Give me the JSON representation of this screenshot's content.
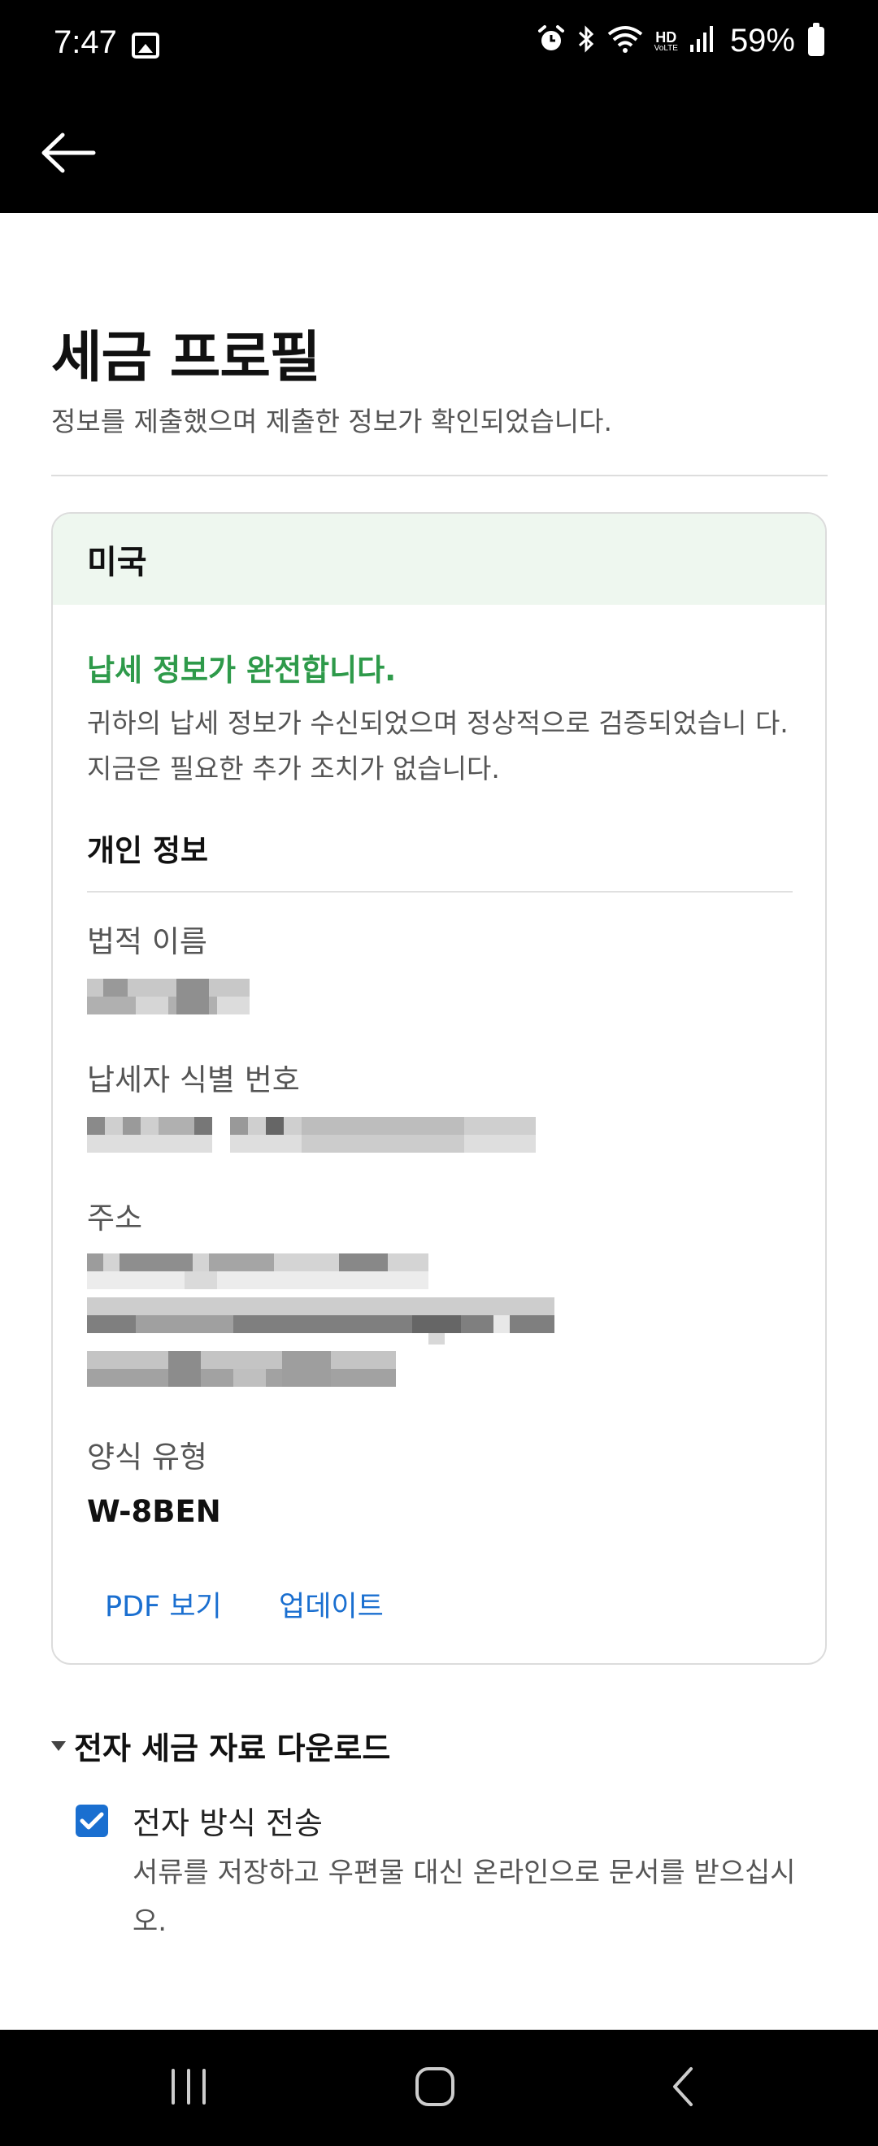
{
  "status_bar": {
    "time": "7:47",
    "battery": "59%",
    "icons": [
      "image-icon",
      "alarm-icon",
      "bluetooth-icon",
      "wifi-icon",
      "hd-voice-icon",
      "signal-icon",
      "battery-icon"
    ],
    "hd_top": "HD",
    "hd_bottom": "VoLTE"
  },
  "app_bar": {
    "back_icon": "arrow-left-icon"
  },
  "page": {
    "title": "세금 프로필",
    "subtitle": "정보를 제출했으며 제출한 정보가 확인되었습니다."
  },
  "card": {
    "country": "미국",
    "status_title": "납세 정보가 완전합니다.",
    "status_desc": "귀하의 납세 정보가 수신되었으며 정상적으로 검증되었습니 다. 지금은 필요한 추가 조치가 없습니다.",
    "section_title": "개인 정보",
    "fields": {
      "legal_name_label": "법적 이름",
      "tin_label": "납세자 식별 번호",
      "address_label": "주소",
      "form_type_label": "양식 유형",
      "form_type_value": "W-8BEN"
    },
    "links": {
      "view_pdf": "PDF 보기",
      "update": "업데이트"
    }
  },
  "electronic": {
    "section_title": "전자 세금 자료 다운로드",
    "checkbox_label": "전자 방식 전송",
    "checkbox_checked": true,
    "description": "서류를 저장하고 우편물 대신 온라인으로 문서를 받으십시 오."
  },
  "nav_bar": {
    "icons": [
      "recent-apps-icon",
      "home-icon",
      "back-icon"
    ]
  },
  "colors": {
    "accent": "#1a6fd0",
    "success": "#2e9a4a",
    "header_tint": "#eef7ef"
  }
}
